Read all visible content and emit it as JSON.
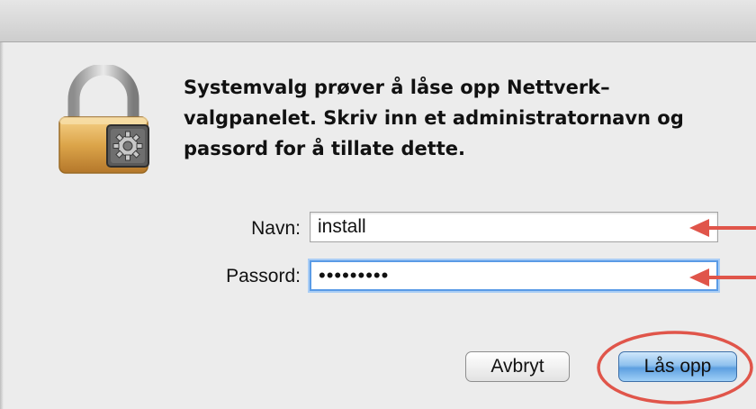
{
  "dialog": {
    "icon": "lock-with-preferences-gear-icon",
    "message": "Systemvalg prøver å låse opp Nettverk-valgpanelet. Skriv inn et administratornavn og passord for å tillate dette.",
    "message_lines": [
      "Systemvalg prøver å låse opp Nettverk–",
      "valgpanelet. Skriv inn et administratornavn og",
      "passord for å tillate dette."
    ]
  },
  "form": {
    "name_label": "Navn:",
    "name_value": "install",
    "password_label": "Passord:",
    "password_value": "•••••••••"
  },
  "buttons": {
    "cancel_label": "Avbryt",
    "unlock_label": "Lås opp"
  },
  "annotations": {
    "arrow_icon": "red-arrow-icon",
    "highlight_shape": "red-ellipse",
    "annotation_color": "#e0554a"
  },
  "colors": {
    "focus_ring": "#5a9be6",
    "default_button": "#5d9fe0"
  }
}
